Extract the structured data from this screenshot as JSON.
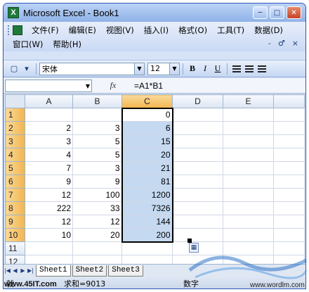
{
  "window": {
    "title": "Microsoft Excel - Book1",
    "app_icon_letter": "X",
    "minimize": "─",
    "maximize": "□",
    "close": "✕"
  },
  "menubar": {
    "row1": [
      "文件(F)",
      "编辑(E)",
      "视图(V)",
      "插入(I)",
      "格式(O)",
      "工具(T)",
      "数据(D)"
    ],
    "row2": [
      "窗口(W)",
      "帮助(H)"
    ],
    "right_controls": [
      "-",
      "♂",
      "×"
    ]
  },
  "toolbar": {
    "font_name": "宋体",
    "font_size": "12",
    "bold": "B",
    "italic": "I",
    "underline": "U"
  },
  "formula_bar": {
    "name_box": "",
    "fx": "fx",
    "formula": "=A1*B1"
  },
  "grid": {
    "columns": [
      "A",
      "B",
      "C",
      "D",
      "E"
    ],
    "rows": [
      {
        "num": "1",
        "a": "",
        "b": "",
        "c": "0"
      },
      {
        "num": "2",
        "a": "2",
        "b": "3",
        "c": "6"
      },
      {
        "num": "3",
        "a": "3",
        "b": "5",
        "c": "15"
      },
      {
        "num": "4",
        "a": "4",
        "b": "5",
        "c": "20"
      },
      {
        "num": "5",
        "a": "7",
        "b": "3",
        "c": "21"
      },
      {
        "num": "6",
        "a": "9",
        "b": "9",
        "c": "81"
      },
      {
        "num": "7",
        "a": "12",
        "b": "100",
        "c": "1200"
      },
      {
        "num": "8",
        "a": "222",
        "b": "33",
        "c": "7326"
      },
      {
        "num": "9",
        "a": "12",
        "b": "12",
        "c": "144"
      },
      {
        "num": "10",
        "a": "10",
        "b": "20",
        "c": "200"
      },
      {
        "num": "11",
        "a": "",
        "b": "",
        "c": ""
      },
      {
        "num": "12",
        "a": "",
        "b": "",
        "c": ""
      }
    ],
    "selected_column": "C",
    "selected_rows": [
      "1",
      "2",
      "3",
      "4",
      "5",
      "6",
      "7",
      "8",
      "9",
      "10"
    ]
  },
  "sheet_tabs": [
    "Sheet1",
    "Sheet2",
    "Sheet3"
  ],
  "status_bar": {
    "ready": "就",
    "sum": "求和=9013",
    "mode": "数字"
  },
  "watermarks": {
    "left": "www.45IT.com",
    "right": "www.wordlm.com"
  },
  "colors": {
    "title_bar": "#8fb2e8",
    "selection_fill": "#c5d9f1",
    "selected_header": "#f3b64e"
  }
}
